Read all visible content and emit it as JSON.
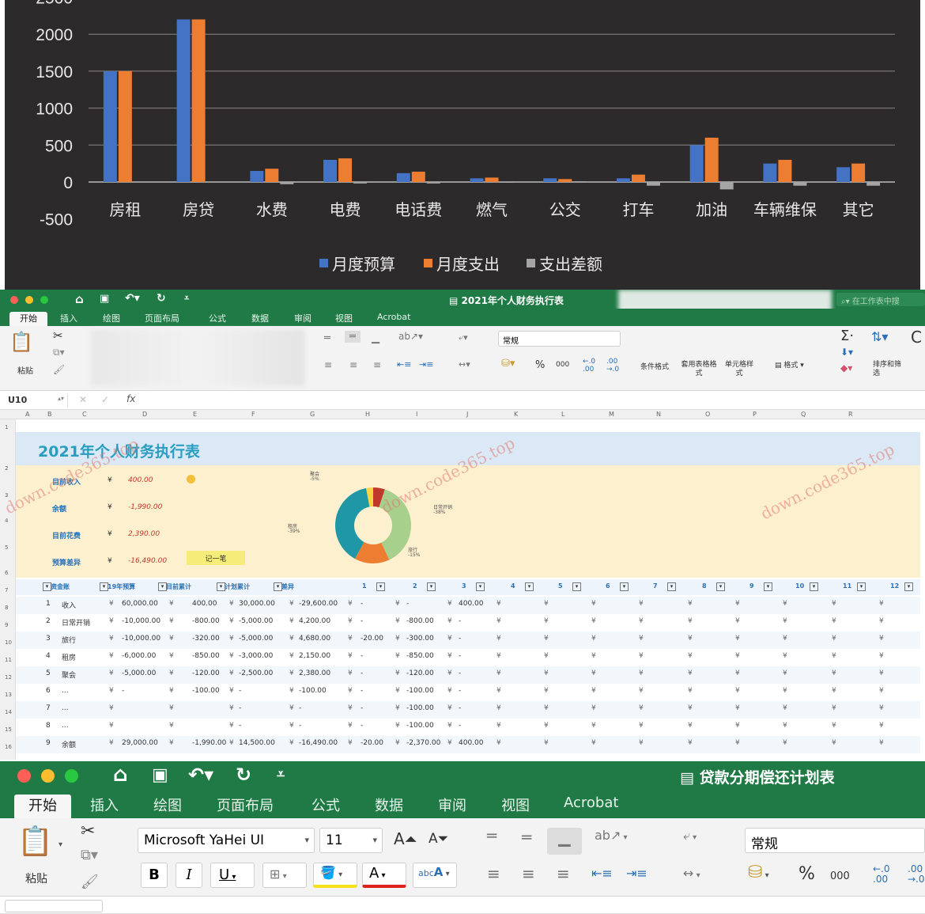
{
  "chart_data": {
    "type": "bar",
    "categories": [
      "房租",
      "房贷",
      "水费",
      "电费",
      "电话费",
      "燃气",
      "公交",
      "打车",
      "加油",
      "车辆维保",
      "其它"
    ],
    "series": [
      {
        "name": "月度预算",
        "values": [
          1500,
          2200,
          150,
          300,
          120,
          50,
          50,
          50,
          500,
          250,
          200
        ]
      },
      {
        "name": "月度支出",
        "values": [
          1500,
          2200,
          180,
          320,
          140,
          60,
          40,
          100,
          600,
          300,
          250
        ]
      },
      {
        "name": "支出差额",
        "values": [
          0,
          0,
          -30,
          -20,
          -20,
          -10,
          10,
          -50,
          -100,
          -50,
          -50
        ]
      }
    ],
    "yticks": [
      -500,
      0,
      500,
      1000,
      1500,
      2000,
      2500
    ],
    "ylim": [
      -500,
      2500
    ],
    "grid": true,
    "legend": "bottom",
    "colors": {
      "budget": "#4472c4",
      "spend": "#ed7d31",
      "diff": "#a5a5a5"
    }
  },
  "win1": {
    "doc_title": "2021年个人财务执行表",
    "search_placeholder": "在工作表中搜",
    "tabs": [
      "开始",
      "插入",
      "绘图",
      "页面布局",
      "公式",
      "数据",
      "审阅",
      "视图",
      "Acrobat"
    ],
    "paste_label": "粘贴",
    "number_format": "常规",
    "percent": "%",
    "thousands": "000",
    "cond_format": "条件格式",
    "table_format": "套用表格格式",
    "cell_style": "单元格样式",
    "format": "格式",
    "sort_filter": "排序和筛选",
    "name_box": "U10",
    "fx": "fx",
    "columns": [
      "A",
      "B",
      "C",
      "D",
      "E",
      "F",
      "G",
      "H",
      "I",
      "J",
      "K",
      "L",
      "M",
      "N",
      "O",
      "P",
      "Q",
      "R"
    ],
    "sheet_title": "2021年个人财务执行表",
    "summary": [
      {
        "label": "目前收入",
        "cur": "¥",
        "value": "400.00"
      },
      {
        "label": "余额",
        "cur": "¥",
        "value": "-1,990.00"
      },
      {
        "label": "目前花费",
        "cur": "¥",
        "value": "2,390.00"
      },
      {
        "label": "预算差异",
        "cur": "¥",
        "value": "-16,490.00"
      }
    ],
    "button_label": "记一笔",
    "pie_labels": [
      {
        "name": "聚会",
        "pct": "-5%"
      },
      {
        "name": "日常开销",
        "pct": "-38%"
      },
      {
        "name": "租房",
        "pct": "-39%"
      },
      {
        "name": "旅行",
        "pct": "-15%"
      }
    ],
    "headers": [
      "资金账",
      "19年预算",
      "目前累计",
      "计划累计",
      "差异",
      "1",
      "2",
      "3",
      "4",
      "5",
      "6",
      "7",
      "8",
      "9",
      "10",
      "11",
      "12"
    ],
    "rows": [
      {
        "n": "1",
        "name": "收入",
        "budget": "60,000.00",
        "cur": "400.00",
        "plan": "30,000.00",
        "diff": "-29,600.00",
        "m1": "-",
        "m2": "-",
        "m3": "400.00"
      },
      {
        "n": "2",
        "name": "日常开销",
        "budget": "-10,000.00",
        "cur": "-800.00",
        "plan": "-5,000.00",
        "diff": "4,200.00",
        "m1": "-",
        "m2": "-800.00",
        "m3": "-"
      },
      {
        "n": "3",
        "name": "旅行",
        "budget": "-10,000.00",
        "cur": "-320.00",
        "plan": "-5,000.00",
        "diff": "4,680.00",
        "m1": "-20.00",
        "m2": "-300.00",
        "m3": "-"
      },
      {
        "n": "4",
        "name": "租房",
        "budget": "-6,000.00",
        "cur": "-850.00",
        "plan": "-3,000.00",
        "diff": "2,150.00",
        "m1": "-",
        "m2": "-850.00",
        "m3": "-"
      },
      {
        "n": "5",
        "name": "聚会",
        "budget": "-5,000.00",
        "cur": "-120.00",
        "plan": "-2,500.00",
        "diff": "2,380.00",
        "m1": "-",
        "m2": "-120.00",
        "m3": "-"
      },
      {
        "n": "6",
        "name": "...",
        "budget": "-",
        "cur": "-100.00",
        "plan": "-",
        "diff": "-100.00",
        "m1": "-",
        "m2": "-100.00",
        "m3": "-"
      },
      {
        "n": "7",
        "name": "...",
        "budget": "",
        "cur": "",
        "plan": "-",
        "diff": "-",
        "m1": "-",
        "m2": "-100.00",
        "m3": "-"
      },
      {
        "n": "8",
        "name": "...",
        "budget": "",
        "cur": "",
        "plan": "-",
        "diff": "-",
        "m1": "-",
        "m2": "-100.00",
        "m3": "-"
      },
      {
        "n": "9",
        "name": "余额",
        "budget": "29,000.00",
        "cur": "-1,990.00",
        "plan": "14,500.00",
        "diff": "-16,490.00",
        "m1": "-20.00",
        "m2": "-2,370.00",
        "m3": "400.00"
      }
    ],
    "row_numbers": [
      "1",
      "2",
      "3",
      "4",
      "5",
      "6",
      "7",
      "8",
      "9",
      "10",
      "11",
      "12",
      "13",
      "14",
      "15",
      "16"
    ],
    "yen": "¥",
    "dash": "-"
  },
  "win2": {
    "doc_title": "贷款分期偿还计划表",
    "tabs": [
      "开始",
      "插入",
      "绘图",
      "页面布局",
      "公式",
      "数据",
      "审阅",
      "视图",
      "Acrobat"
    ],
    "font_name": "Microsoft YaHei UI",
    "font_size": "11",
    "paste_label": "粘贴",
    "number_format": "常规",
    "bold": "B",
    "italic": "I",
    "underline": "U",
    "percent": "%",
    "thousands": "000"
  },
  "watermark": "down.code365.top"
}
